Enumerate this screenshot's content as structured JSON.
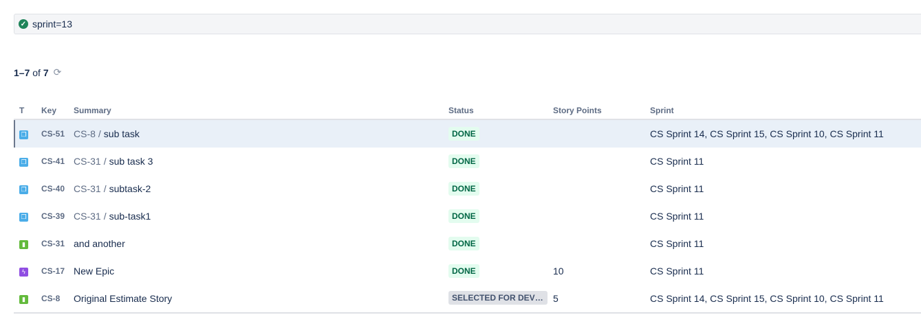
{
  "query": {
    "text": "sprint=13",
    "status_icon": "check-circle-icon"
  },
  "results": {
    "range": "1–7",
    "of": "of",
    "total": "7",
    "refresh_icon": "refresh-icon"
  },
  "columns": {
    "type": "T",
    "key": "Key",
    "summary": "Summary",
    "status": "Status",
    "story_points": "Story Points",
    "sprint": "Sprint"
  },
  "rows": [
    {
      "type": "subtask",
      "key": "CS-51",
      "parent": "CS-8",
      "summary": "sub task",
      "status": "DONE",
      "status_cat": "done",
      "story_points": "",
      "sprint": "CS Sprint 14, CS Sprint 15, CS Sprint 10, CS Sprint 11"
    },
    {
      "type": "subtask",
      "key": "CS-41",
      "parent": "CS-31",
      "summary": "sub task 3",
      "status": "DONE",
      "status_cat": "done",
      "story_points": "",
      "sprint": "CS Sprint 11"
    },
    {
      "type": "subtask",
      "key": "CS-40",
      "parent": "CS-31",
      "summary": "subtask-2",
      "status": "DONE",
      "status_cat": "done",
      "story_points": "",
      "sprint": "CS Sprint 11"
    },
    {
      "type": "subtask",
      "key": "CS-39",
      "parent": "CS-31",
      "summary": "sub-task1",
      "status": "DONE",
      "status_cat": "done",
      "story_points": "",
      "sprint": "CS Sprint 11"
    },
    {
      "type": "story",
      "key": "CS-31",
      "parent": "",
      "summary": "and another",
      "status": "DONE",
      "status_cat": "done",
      "story_points": "",
      "sprint": "CS Sprint 11"
    },
    {
      "type": "epic",
      "key": "CS-17",
      "parent": "",
      "summary": "New Epic",
      "status": "DONE",
      "status_cat": "done",
      "story_points": "10",
      "sprint": "CS Sprint 11"
    },
    {
      "type": "story",
      "key": "CS-8",
      "parent": "",
      "summary": "Original Estimate Story",
      "status": "SELECTED FOR DEVELOPMENT",
      "status_cat": "todo",
      "story_points": "5",
      "sprint": "CS Sprint 14, CS Sprint 15, CS Sprint 10, CS Sprint 11"
    }
  ],
  "separator": "/"
}
